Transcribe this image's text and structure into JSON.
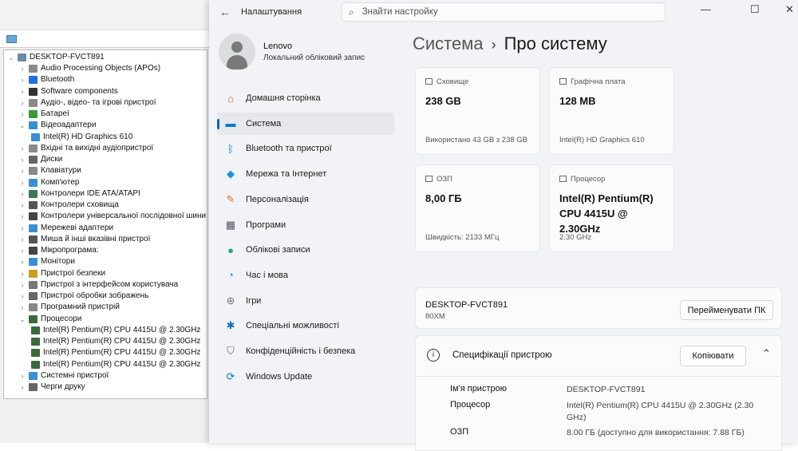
{
  "device_manager": {
    "root": "DESKTOP-FVCT891",
    "nodes": [
      {
        "label": "Audio Processing Objects (APOs)",
        "icon": "speaker-icon",
        "color": "#8a8a8a",
        "level": 1,
        "state": "collapsed"
      },
      {
        "label": "Bluetooth",
        "icon": "bluetooth-icon",
        "color": "#1f6fe0",
        "level": 1,
        "state": "collapsed"
      },
      {
        "label": "Software components",
        "icon": "software-component-icon",
        "color": "#333",
        "level": 1,
        "state": "collapsed"
      },
      {
        "label": "Аудіо-, відео- та ігрові пристрої",
        "icon": "speaker-icon",
        "color": "#8a8a8a",
        "level": 1,
        "state": "collapsed"
      },
      {
        "label": "Батареї",
        "icon": "battery-icon",
        "color": "#3a9a3a",
        "level": 1,
        "state": "collapsed"
      },
      {
        "label": "Відеоадаптери",
        "icon": "display-adapter-icon",
        "color": "#3a8fd0",
        "level": 1,
        "state": "expanded"
      },
      {
        "label": "Intel(R) HD Graphics 610",
        "icon": "display-adapter-icon",
        "color": "#3a8fd0",
        "level": 2,
        "state": "leaf"
      },
      {
        "label": "Вхідні та вихідні аудіопристрої",
        "icon": "speaker-icon",
        "color": "#8a8a8a",
        "level": 1,
        "state": "collapsed"
      },
      {
        "label": "Диски",
        "icon": "disk-icon",
        "color": "#666",
        "level": 1,
        "state": "collapsed"
      },
      {
        "label": "Клавіатури",
        "icon": "keyboard-icon",
        "color": "#888",
        "level": 1,
        "state": "collapsed"
      },
      {
        "label": "Комп'ютер",
        "icon": "computer-icon",
        "color": "#3a8fd0",
        "level": 1,
        "state": "collapsed"
      },
      {
        "label": "Контролери IDE ATA/ATAPI",
        "icon": "ide-controller-icon",
        "color": "#3a7a5a",
        "level": 1,
        "state": "collapsed"
      },
      {
        "label": "Контролери сховища",
        "icon": "storage-controller-icon",
        "color": "#555",
        "level": 1,
        "state": "collapsed"
      },
      {
        "label": "Контролери універсальної послідовної шини",
        "icon": "usb-icon",
        "color": "#444",
        "level": 1,
        "state": "collapsed"
      },
      {
        "label": "Мережеві адаптери",
        "icon": "network-adapter-icon",
        "color": "#3a8fd0",
        "level": 1,
        "state": "collapsed"
      },
      {
        "label": "Миша й інші вказівні пристрої",
        "icon": "mouse-icon",
        "color": "#555",
        "level": 1,
        "state": "collapsed"
      },
      {
        "label": "Мікропрограма:",
        "icon": "firmware-icon",
        "color": "#444",
        "level": 1,
        "state": "collapsed"
      },
      {
        "label": "Монітори",
        "icon": "monitor-icon",
        "color": "#3a8fd0",
        "level": 1,
        "state": "collapsed"
      },
      {
        "label": "Пристрої безпеки",
        "icon": "security-device-icon",
        "color": "#c8a020",
        "level": 1,
        "state": "collapsed"
      },
      {
        "label": "Пристрої з інтерфейсом користувача",
        "icon": "hid-icon",
        "color": "#777",
        "level": 1,
        "state": "collapsed"
      },
      {
        "label": "Пристрої обробки зображень",
        "icon": "camera-icon",
        "color": "#666",
        "level": 1,
        "state": "collapsed"
      },
      {
        "label": "Програмний пристрій",
        "icon": "software-device-icon",
        "color": "#888",
        "level": 1,
        "state": "collapsed"
      },
      {
        "label": "Процесори",
        "icon": "processor-icon",
        "color": "#3a6a3a",
        "level": 1,
        "state": "expanded"
      },
      {
        "label": "Intel(R) Pentium(R) CPU 4415U @ 2.30GHz",
        "icon": "processor-icon",
        "color": "#3a6a3a",
        "level": 2,
        "state": "leaf"
      },
      {
        "label": "Intel(R) Pentium(R) CPU 4415U @ 2.30GHz",
        "icon": "processor-icon",
        "color": "#3a6a3a",
        "level": 2,
        "state": "leaf"
      },
      {
        "label": "Intel(R) Pentium(R) CPU 4415U @ 2.30GHz",
        "icon": "processor-icon",
        "color": "#3a6a3a",
        "level": 2,
        "state": "leaf"
      },
      {
        "label": "Intel(R) Pentium(R) CPU 4415U @ 2.30GHz",
        "icon": "processor-icon",
        "color": "#3a6a3a",
        "level": 2,
        "state": "leaf"
      },
      {
        "label": "Системні пристрої",
        "icon": "system-devices-icon",
        "color": "#3a8fd0",
        "level": 1,
        "state": "collapsed"
      },
      {
        "label": "Черги друку",
        "icon": "printer-icon",
        "color": "#666",
        "level": 1,
        "state": "collapsed"
      }
    ]
  },
  "settings": {
    "title": "Налаштування",
    "search_placeholder": "Знайти настройку",
    "profile": {
      "name": "Lenovo",
      "account": "Локальний обліковий запис"
    },
    "accent": "#0067c0",
    "nav": [
      {
        "label": "Домашня сторінка",
        "icon": "home-icon",
        "glyph": "⌂",
        "color": "#c86a2a"
      },
      {
        "label": "Система",
        "icon": "system-icon",
        "glyph": "▬",
        "color": "#0078d4",
        "active": true
      },
      {
        "label": "Bluetooth та пристрої",
        "icon": "bluetooth-icon",
        "glyph": "ᛒ",
        "color": "#0078d4"
      },
      {
        "label": "Мережа та Інтернет",
        "icon": "wifi-icon",
        "glyph": "◆",
        "color": "#1e90e0"
      },
      {
        "label": "Персоналізація",
        "icon": "brush-icon",
        "glyph": "✎",
        "color": "#d07a30"
      },
      {
        "label": "Програми",
        "icon": "apps-icon",
        "glyph": "▦",
        "color": "#556"
      },
      {
        "label": "Облікові записи",
        "icon": "accounts-icon",
        "glyph": "●",
        "color": "#2aa876"
      },
      {
        "label": "Час і мова",
        "icon": "time-language-icon",
        "glyph": "◔",
        "color": "#1e90e0"
      },
      {
        "label": "Ігри",
        "icon": "gaming-icon",
        "glyph": "⊕",
        "color": "#778"
      },
      {
        "label": "Спеціальні можливості",
        "icon": "accessibility-icon",
        "glyph": "✱",
        "color": "#0a6fc2"
      },
      {
        "label": "Конфіденційність і безпека",
        "icon": "shield-icon",
        "glyph": "⛉",
        "color": "#667"
      },
      {
        "label": "Windows Update",
        "icon": "windows-update-icon",
        "glyph": "⟳",
        "color": "#0a78d4"
      }
    ],
    "breadcrumb": {
      "parent": "Система",
      "separator": "›",
      "current": "Про систему"
    },
    "cards": [
      {
        "label": "Сховище",
        "icon": "storage-icon",
        "value": "238 GB",
        "sub": "Використано 43 GB з 238 GB"
      },
      {
        "label": "Графічна плата",
        "icon": "graphics-card-icon",
        "value": "128 MB",
        "sub": "Intel(R) HD Graphics 610"
      },
      {
        "label": "ОЗП",
        "icon": "ram-icon",
        "value": "8,00 ГБ",
        "sub": "Швидкість: 2133 МГц"
      },
      {
        "label": "Процесор",
        "icon": "processor-icon",
        "value": "Intel(R) Pentium(R) CPU 4415U @ 2.30GHz",
        "sub": "2.30 GHz"
      }
    ],
    "device": {
      "name": "DESKTOP-FVCT891",
      "model": "80XM",
      "rename_label": "Перейменувати ПК"
    },
    "specs": {
      "title": "Специфікації пристрою",
      "copy_label": "Копіювати",
      "rows": [
        {
          "label": "Ім'я пристрою",
          "value": "DESKTOP-FVCT891"
        },
        {
          "label": "Процесор",
          "value": "Intel(R) Pentium(R) CPU 4415U @ 2.30GHz (2.30 GHz)"
        },
        {
          "label": "ОЗП",
          "value": "8.00 ГБ (доступно для використання: 7.88 ГБ)"
        }
      ]
    }
  }
}
